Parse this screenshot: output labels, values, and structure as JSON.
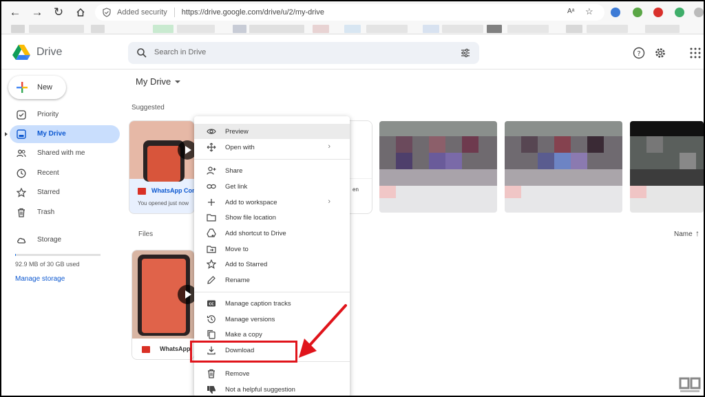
{
  "browser": {
    "security_label": "Added security",
    "url": "https://drive.google.com/drive/u/2/my-drive"
  },
  "header": {
    "brand": "Drive",
    "search_placeholder": "Search in Drive"
  },
  "sidebar": {
    "new_label": "New",
    "items": [
      {
        "label": "Priority"
      },
      {
        "label": "My Drive"
      },
      {
        "label": "Shared with me"
      },
      {
        "label": "Recent"
      },
      {
        "label": "Starred"
      },
      {
        "label": "Trash"
      }
    ],
    "storage_label": "Storage",
    "storage_used": "92.9 MB of 30 GB used",
    "storage_fraction": 0.003,
    "manage_storage": "Manage storage"
  },
  "main": {
    "title": "My Drive",
    "suggested_label": "Suggested",
    "files_label": "Files",
    "sort_label": "Name",
    "suggested_cards": [
      {
        "name": "WhatsApp Com",
        "subtitle": "You opened just now"
      },
      {
        "name": "en"
      }
    ],
    "files": [
      {
        "name": "WhatsApp"
      }
    ]
  },
  "context_menu": {
    "items": [
      {
        "label": "Preview",
        "icon": "eye-icon"
      },
      {
        "label": "Open with",
        "icon": "move-icon",
        "submenu": true
      },
      {
        "label": "Share",
        "icon": "person-add-icon"
      },
      {
        "label": "Get link",
        "icon": "link-icon"
      },
      {
        "label": "Add to workspace",
        "icon": "plus-icon",
        "submenu": true
      },
      {
        "label": "Show file location",
        "icon": "folder-icon"
      },
      {
        "label": "Add shortcut to Drive",
        "icon": "shortcut-icon"
      },
      {
        "label": "Move to",
        "icon": "move-to-icon"
      },
      {
        "label": "Add to Starred",
        "icon": "star-icon"
      },
      {
        "label": "Rename",
        "icon": "pencil-icon"
      },
      {
        "label": "Manage caption tracks",
        "icon": "cc-icon"
      },
      {
        "label": "Manage versions",
        "icon": "history-icon"
      },
      {
        "label": "Make a copy",
        "icon": "copy-icon"
      },
      {
        "label": "Download",
        "icon": "download-icon"
      },
      {
        "label": "Remove",
        "icon": "trash-icon"
      },
      {
        "label": "Not a helpful suggestion",
        "icon": "thumbs-down-icon"
      }
    ]
  },
  "colors": {
    "accent": "#0b57d0",
    "active_nav": "#c9defd",
    "annotation_red": "#e0141b"
  }
}
